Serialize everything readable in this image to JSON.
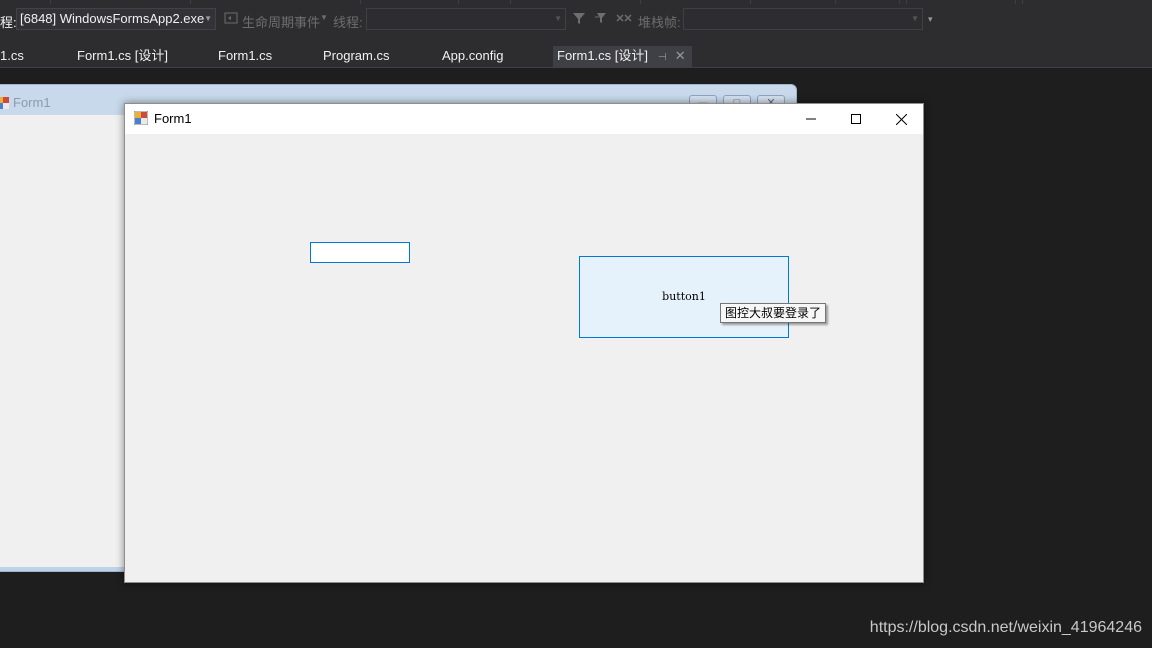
{
  "toolbar": {
    "process_label": "程:",
    "process_value": "[6848] WindowsFormsApp2.exe",
    "lifecycle_label": "生命周期事件",
    "thread_label": "线程:",
    "thread_value": "",
    "stackframe_label": "堆栈帧:",
    "stackframe_value": ""
  },
  "tabs": [
    {
      "label": "1.cs"
    },
    {
      "label": "Form1.cs [设计]"
    },
    {
      "label": "Form1.cs"
    },
    {
      "label": "Program.cs"
    },
    {
      "label": "App.config"
    },
    {
      "label": "Form1.cs [设计]",
      "active": true
    }
  ],
  "designer_form": {
    "title": "Form1"
  },
  "form": {
    "title": "Form1",
    "textbox_value": "",
    "button_label": "button1",
    "tooltip": "图控大叔要登录了"
  },
  "watermark": "https://blog.csdn.net/weixin_41964246",
  "colors": {
    "ide_background": "#1e1e1e",
    "toolbar": "#2d2d30",
    "accent_focus": "#0078d7",
    "button_face": "#e5f1fb",
    "form_client": "#f0f0f0"
  },
  "icons": [
    "app-icon",
    "minimize-icon",
    "maximize-icon",
    "close-icon",
    "filter-icon",
    "dropdown-arrow-icon",
    "pin-icon"
  ]
}
